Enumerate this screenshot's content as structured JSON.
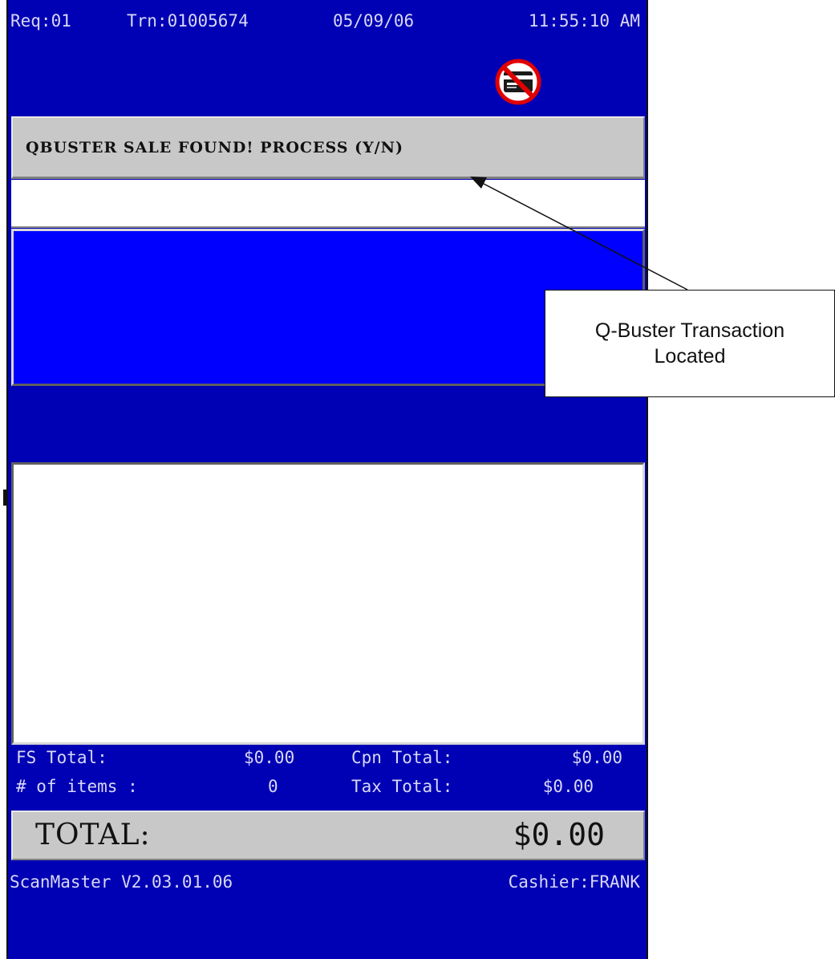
{
  "header": {
    "register": "Req:01",
    "transaction": "Trn:01005674",
    "date": "05/09/06",
    "time": "11:55:10 AM"
  },
  "status_icon": "no-credit-card-icon",
  "prompt": {
    "message": "QBUSTER SALE FOUND! PROCESS (Y/N)"
  },
  "input": {
    "value": ""
  },
  "totals": {
    "fs_label": "FS Total:",
    "fs_value": "$0.00",
    "cpn_label": "Cpn Total:",
    "cpn_value": "$0.00",
    "items_label": "# of items :",
    "items_value": "0",
    "tax_label": "Tax Total:",
    "tax_value": "$0.00"
  },
  "grand_total": {
    "label": "TOTAL:",
    "value": "$0.00"
  },
  "footer": {
    "version": "ScanMaster V2.03.01.06",
    "cashier": "Cashier:FRANK"
  },
  "callout": {
    "text": "Q-Buster Transaction Located"
  },
  "colors": {
    "screen_background": "#0000b4",
    "info_panel": "#0000ff",
    "prompt_bar": "#c8c8c8",
    "status_text": "#d8d8f8"
  }
}
